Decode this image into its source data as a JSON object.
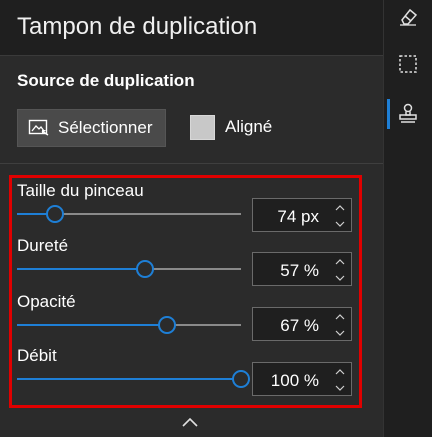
{
  "title": "Tampon de duplication",
  "source": {
    "heading": "Source de duplication",
    "select_button": "Sélectionner",
    "aligned_label": "Aligné",
    "aligned_checked": false
  },
  "params": [
    {
      "label": "Taille du pinceau",
      "value": "74 px",
      "level": 0.17
    },
    {
      "label": "Dureté",
      "value": "57 %",
      "level": 0.57
    },
    {
      "label": "Opacité",
      "value": "67 %",
      "level": 0.67
    },
    {
      "label": "Débit",
      "value": "100 %",
      "level": 1.0
    }
  ],
  "rail": {
    "icons": [
      "eraser-icon",
      "selection-icon",
      "clone-stamp-icon"
    ],
    "active": "clone-stamp-icon"
  },
  "colors": {
    "accent": "#1e7fd6",
    "highlight": "#e00000",
    "panel": "#2b2b2b"
  }
}
